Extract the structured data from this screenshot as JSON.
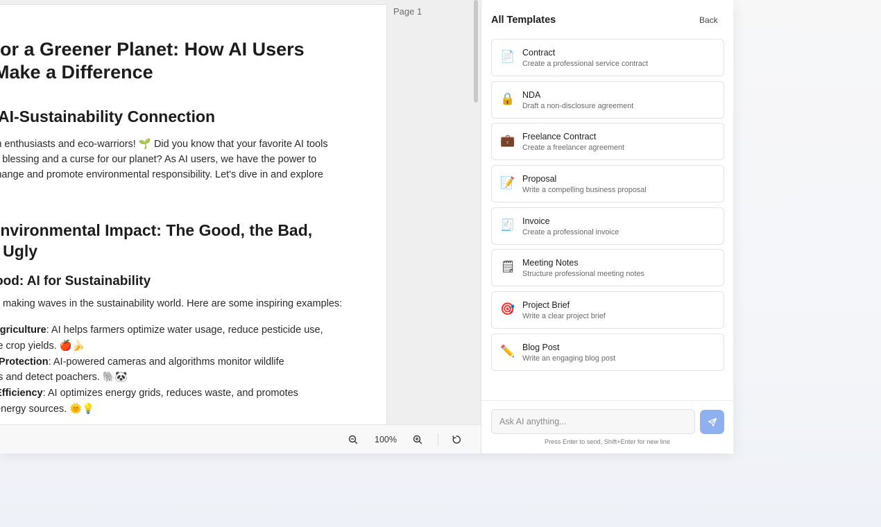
{
  "document": {
    "page_label": "Page 1",
    "title": "for a Greener Planet: How AI Users\nMake a Difference",
    "section1_heading": "AI-Sustainability Connection",
    "intro_line1": "tech enthusiasts and eco-warriors! 🌱 Did you know that your favorite AI tools",
    "intro_line2": "th a blessing and a curse for our planet? As AI users, we have the power to",
    "intro_line3": "e change and promote environmental responsibility. Let's dive in and explore",
    "section2_heading": "Environmental Impact: The Good, the Bad,\ne Ugly",
    "subsection_heading": "ood: AI for Sustainability",
    "subsection_intro": "making waves in the sustainability world. Here are some inspiring examples:",
    "list": [
      {
        "bold": "t Agriculture",
        "text": ": AI helps farmers optimize water usage, reduce pesticide use,"
      },
      {
        "bold": "",
        "text": "ove crop yields. 🍎🍌"
      },
      {
        "bold": "fe Protection",
        "text": ": AI-powered cameras and algorithms monitor wildlife"
      },
      {
        "bold": "",
        "text": "ons and detect poachers. 🐘🐼"
      },
      {
        "bold": "y Efficiency",
        "text": ": AI optimizes energy grids, reduces waste, and promotes"
      },
      {
        "bold": "",
        "text": "e energy sources. 🌞💡"
      }
    ]
  },
  "toolbar": {
    "zoom_out_icon": "zoom-out-icon",
    "zoom_level": "100%",
    "zoom_in_icon": "zoom-in-icon",
    "rotate_icon": "rotate-icon"
  },
  "panel": {
    "title": "All Templates",
    "back_label": "Back",
    "templates": [
      {
        "icon": "📄",
        "icon_name": "document-icon",
        "name": "Contract",
        "description": "Create a professional service contract"
      },
      {
        "icon": "🔒",
        "icon_name": "lock-icon",
        "name": "NDA",
        "description": "Draft a non-disclosure agreement"
      },
      {
        "icon": "💼",
        "icon_name": "briefcase-icon",
        "name": "Freelance Contract",
        "description": "Create a freelancer agreement"
      },
      {
        "icon": "📝",
        "icon_name": "memo-icon",
        "name": "Proposal",
        "description": "Write a compelling business proposal"
      },
      {
        "icon": "🧾",
        "icon_name": "receipt-icon",
        "name": "Invoice",
        "description": "Create a professional invoice"
      },
      {
        "icon": "🗒",
        "icon_name": "notepad-icon",
        "name": "Meeting Notes",
        "description": "Structure professional meeting notes"
      },
      {
        "icon": "🎯",
        "icon_name": "target-icon",
        "name": "Project Brief",
        "description": "Write a clear project brief"
      },
      {
        "icon": "✏️",
        "icon_name": "pencil-icon",
        "name": "Blog Post",
        "description": "Write an engaging blog post"
      }
    ],
    "chat": {
      "placeholder": "Ask AI anything...",
      "send_icon": "send-icon",
      "hint": "Press Enter to send, Shift+Enter for new line"
    }
  },
  "colors": {
    "accent": "#8fb0ef",
    "panel_bg": "#ffffff",
    "canvas_bg": "#efefef"
  }
}
